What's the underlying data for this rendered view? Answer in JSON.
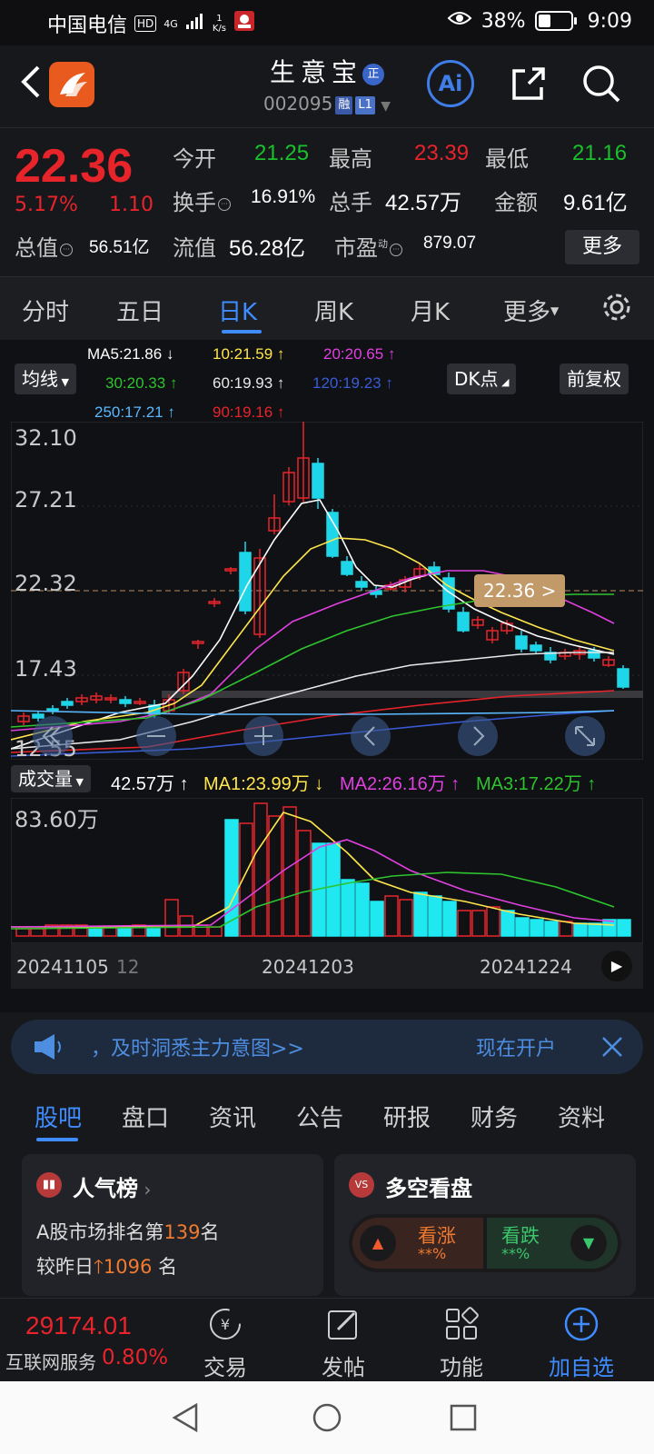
{
  "status": {
    "carrier": "中国电信",
    "hd": "HD",
    "network_type": "4G",
    "speed_value": "1",
    "speed_unit": "K/s",
    "battery": "38%",
    "battery_level": 0.38,
    "time": "9:09"
  },
  "header": {
    "title": "生意宝",
    "badge": "正",
    "code": "002095",
    "tag_margin": "融",
    "tag_level": "L1",
    "ai_label": "Ai"
  },
  "quote": {
    "price": "22.36",
    "change_pct": "5.17%",
    "change_amt": "1.10",
    "open_label": "今开",
    "open": "21.25",
    "high_label": "最高",
    "high": "23.39",
    "low_label": "最低",
    "low": "21.16",
    "turnover_label": "换手",
    "turnover": "16.91%",
    "volume_label": "总手",
    "volume": "42.57万",
    "amount_label": "金额",
    "amount": "9.61亿",
    "mktcap_label": "总值",
    "mktcap": "56.51亿",
    "float_label": "流值",
    "float_cap": "56.28亿",
    "pe_label": "市盈",
    "pe_sup": "动",
    "pe": "879.07",
    "more_btn": "更多"
  },
  "tabs": [
    "分时",
    "五日",
    "日K",
    "周K",
    "月K",
    "更多"
  ],
  "active_tab": 2,
  "indicators": {
    "ma_btn": "均线",
    "dk_btn": "DK点",
    "fq_btn": "前复权",
    "ma5": "MA5:21.86 ↓",
    "ma10": "10:21.59 ↑",
    "ma20": "20:20.65 ↑",
    "ma30": "30:20.33 ↑",
    "ma60": "60:19.93 ↑",
    "ma120": "120:19.23 ↑",
    "ma250": "250:17.21 ↑",
    "ma90": "90:19.16 ↑",
    "colors": {
      "ma5": "#ffffff",
      "ma10": "#ffe64d",
      "ma20": "#e040e0",
      "ma30": "#2ec42e",
      "ma60": "#e8e8e8",
      "ma120": "#3a5bd8",
      "ma250": "#5ab8ff",
      "ma90": "#e8242b"
    }
  },
  "price_axis": [
    "32.10",
    "27.21",
    "22.32",
    "17.43",
    "12.55"
  ],
  "current_price_tag": "22.36 >",
  "volume_panel": {
    "label": "成交量",
    "vol": "42.57万 ↑",
    "ma1": "MA1:23.99万 ↓",
    "ma2": "MA2:26.16万 ↑",
    "ma3": "MA3:17.22万 ↑",
    "axis_max": "83.60万"
  },
  "dates": [
    "20241105",
    "12",
    "20241203",
    "20241224"
  ],
  "banner": {
    "text": "，及时洞悉主力意图>>",
    "action": "现在开户"
  },
  "bottom_tabs": [
    "股吧",
    "盘口",
    "资讯",
    "公告",
    "研报",
    "财务",
    "资料"
  ],
  "cards": {
    "popularity_title": "人气榜",
    "popularity_rank_prefix": "A股市场排名第",
    "popularity_rank": "139",
    "popularity_rank_suffix": "名",
    "popularity_change_prefix": "较昨日",
    "popularity_change": "1096",
    "popularity_change_suffix": "名",
    "bullbear_title": "多空看盘",
    "bull_label": "看涨",
    "bull_value": "**%",
    "bear_label": "看跌",
    "bear_value": "**%"
  },
  "bottom_nav": {
    "index_value": "29174.01",
    "index_name": "互联网服务",
    "index_change": "0.80%",
    "trade": "交易",
    "post": "发帖",
    "function": "功能",
    "add_watch": "加自选"
  }
}
